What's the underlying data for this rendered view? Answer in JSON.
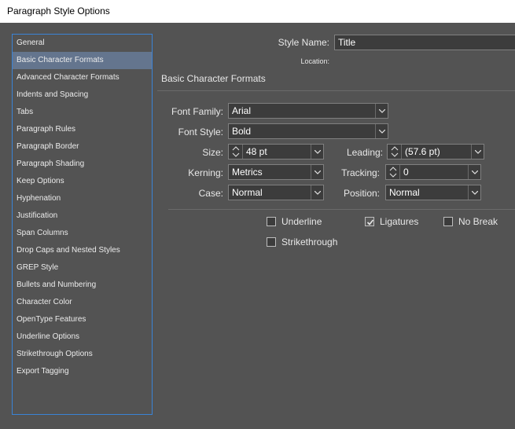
{
  "window": {
    "title": "Paragraph Style Options"
  },
  "sidebar": {
    "items": [
      "General",
      "Basic Character Formats",
      "Advanced Character Formats",
      "Indents and Spacing",
      "Tabs",
      "Paragraph Rules",
      "Paragraph Border",
      "Paragraph Shading",
      "Keep Options",
      "Hyphenation",
      "Justification",
      "Span Columns",
      "Drop Caps and Nested Styles",
      "GREP Style",
      "Bullets and Numbering",
      "Character Color",
      "OpenType Features",
      "Underline Options",
      "Strikethrough Options",
      "Export Tagging"
    ],
    "selected": "Basic Character Formats"
  },
  "header": {
    "style_name_label": "Style Name:",
    "style_name_value": "Title",
    "location_label": "Location:"
  },
  "section": {
    "title": "Basic Character Formats"
  },
  "form": {
    "font_family_label": "Font Family:",
    "font_family_value": "Arial",
    "font_style_label": "Font Style:",
    "font_style_value": "Bold",
    "size_label": "Size:",
    "size_value": "48 pt",
    "leading_label": "Leading:",
    "leading_value": "(57.6 pt)",
    "kerning_label": "Kerning:",
    "kerning_value": "Metrics",
    "tracking_label": "Tracking:",
    "tracking_value": "0",
    "case_label": "Case:",
    "case_value": "Normal",
    "position_label": "Position:",
    "position_value": "Normal"
  },
  "options": {
    "underline": {
      "label": "Underline",
      "checked": false
    },
    "ligatures": {
      "label": "Ligatures",
      "checked": true
    },
    "no_break": {
      "label": "No Break",
      "checked": false
    },
    "strikethrough": {
      "label": "Strikethrough",
      "checked": false
    }
  }
}
